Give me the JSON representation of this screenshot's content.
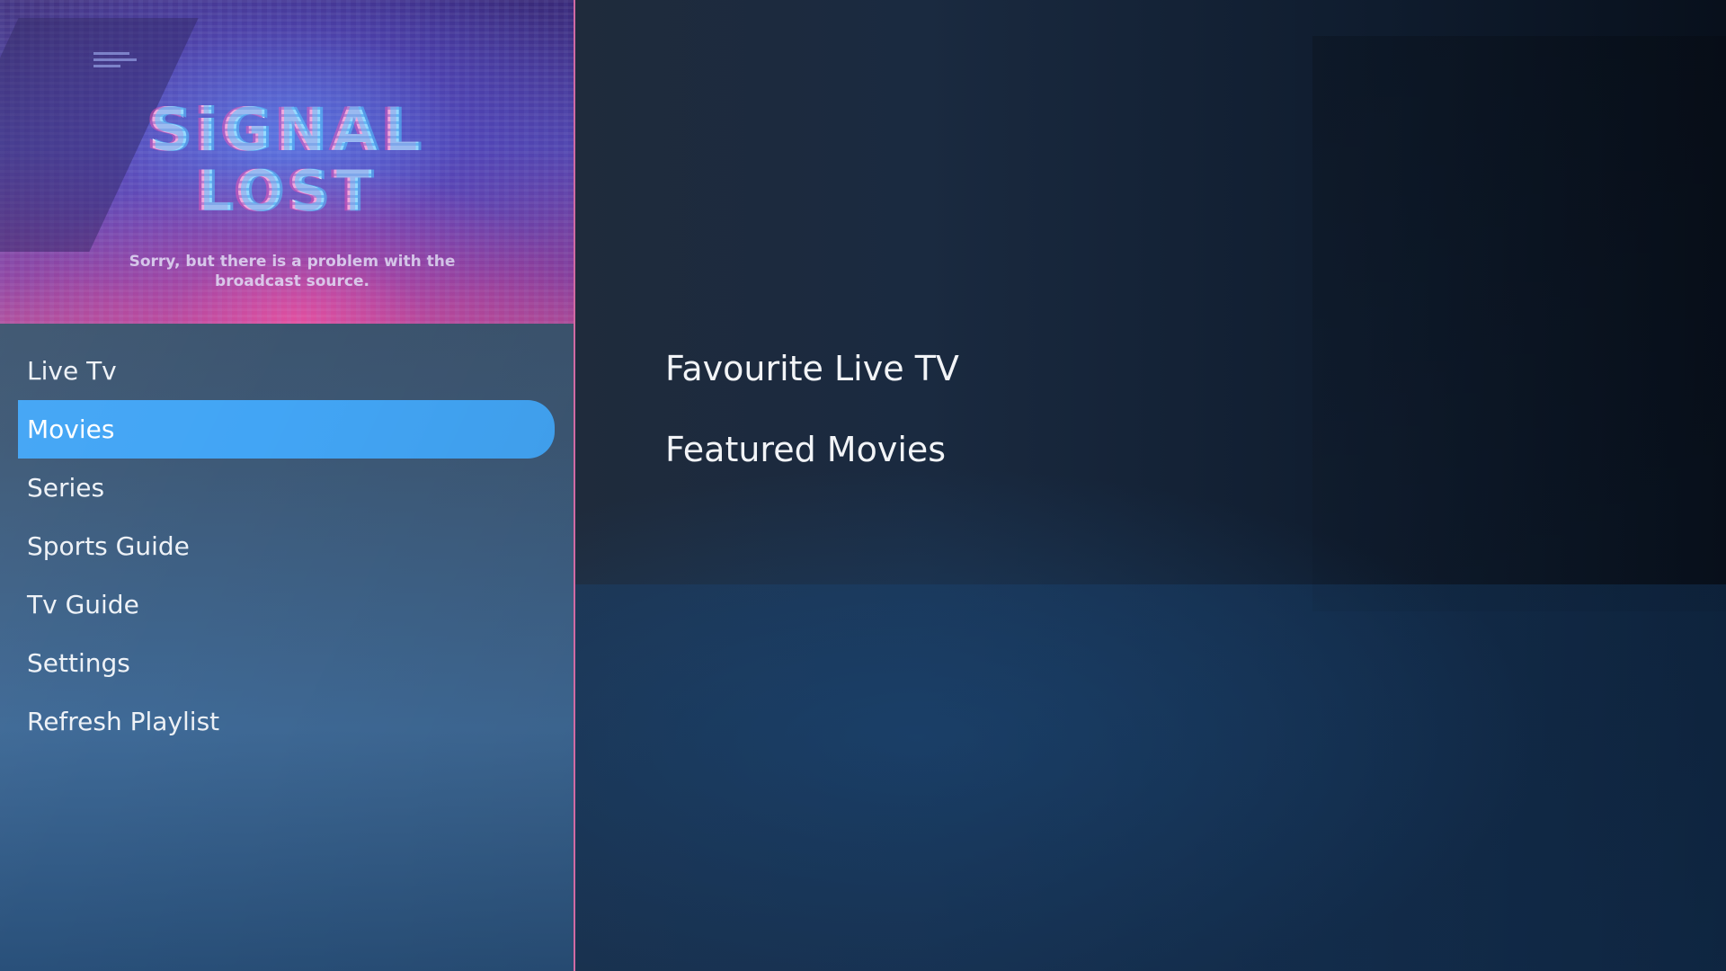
{
  "preview": {
    "title_line1": "SiGNAL",
    "title_line2": "LOST",
    "message": "Sorry, but there is a problem with the broadcast source."
  },
  "menu": {
    "items": [
      {
        "label": "Live Tv"
      },
      {
        "label": "Movies"
      },
      {
        "label": "Series"
      },
      {
        "label": "Sports Guide"
      },
      {
        "label": "Tv Guide"
      },
      {
        "label": "Settings"
      },
      {
        "label": "Refresh Playlist"
      }
    ],
    "selected": "Movies"
  },
  "main": {
    "sections": [
      {
        "title": "Favourite Live TV"
      },
      {
        "title": "Featured Movies"
      }
    ]
  },
  "colors": {
    "selection": "#42a5f5",
    "divider": "#d06aa3"
  }
}
